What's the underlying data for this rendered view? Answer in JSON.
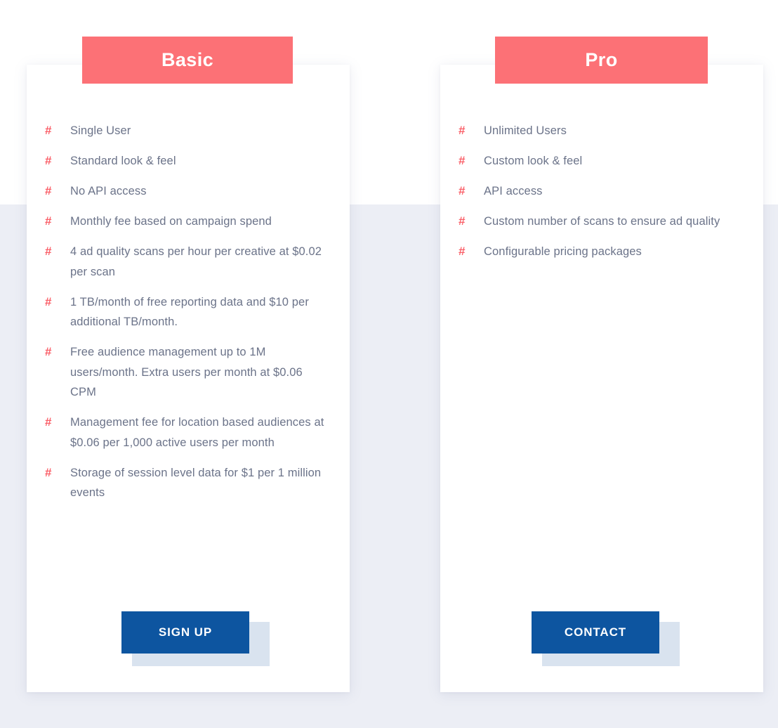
{
  "theme": {
    "accent_coral": "#fc7176",
    "bullet_color": "#fa5f68",
    "button_blue": "#0d55a0",
    "button_shadow": "#d9e3ef",
    "body_text": "#6b7389",
    "page_bg_top": "#ffffff",
    "page_bg_bottom": "#eceef5",
    "card_bg": "#ffffff"
  },
  "plans": [
    {
      "id": "basic",
      "title": "Basic",
      "bullet_glyph": "#",
      "features": [
        "Single User",
        "Standard look & feel",
        "No API access",
        "Monthly fee based on campaign spend",
        "4 ad quality scans per hour per creative at $0.02 per scan",
        "1 TB/month of free reporting data and $10 per additional TB/month.",
        "Free audience management up to 1M users/month. Extra users per month at $0.06 CPM",
        "Management fee for location based audiences at $0.06 per 1,000 active users per month",
        "Storage of session level data for $1 per 1 million events"
      ],
      "cta_label": "SIGN UP"
    },
    {
      "id": "pro",
      "title": "Pro",
      "bullet_glyph": "#",
      "features": [
        "Unlimited Users",
        "Custom look & feel",
        "API access",
        "Custom number of scans to ensure ad quality",
        "Configurable pricing packages"
      ],
      "cta_label": "CONTACT"
    }
  ]
}
